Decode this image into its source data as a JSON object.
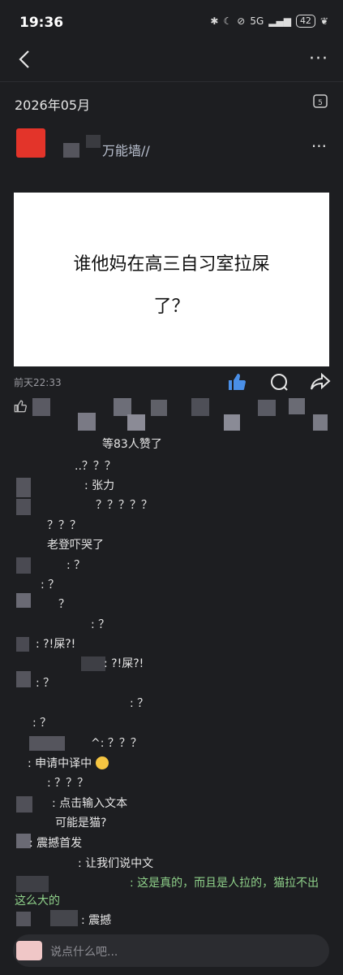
{
  "status_bar": {
    "time": "19:36",
    "network": "5G",
    "battery": "42"
  },
  "header": {
    "date": "2026年05月",
    "calendar_day": "5"
  },
  "post": {
    "author_name": "万能墙//",
    "image_text_line1": "谁他妈在高三自习室拉屎",
    "image_text_line2": "了？",
    "time": "前天22:33",
    "likes_text": "等83人赞了"
  },
  "comments": [
    {
      "text": "..？？？"
    },
    {
      "text": ": 张力"
    },
    {
      "text": "？？？？？"
    },
    {
      "text": "？？？"
    },
    {
      "text": "老登吓哭了"
    },
    {
      "text": ": ？"
    },
    {
      "text": ": ？"
    },
    {
      "text": "？"
    },
    {
      "text": ": ？"
    },
    {
      "text": ": ?!屎?!"
    },
    {
      "text": ": ?!屎?!"
    },
    {
      "text": ": ？"
    },
    {
      "text": ": ？"
    },
    {
      "text": ": ？"
    },
    {
      "text": "^: ？？？"
    },
    {
      "text": ": 申请中译中"
    },
    {
      "text": ": ？？？"
    },
    {
      "text": ": 点击输入文本"
    },
    {
      "text": "可能是猫?"
    },
    {
      "text": ": 震撼首发"
    },
    {
      "text": ": 让我们说中文"
    },
    {
      "text": ": 这是真的，而且是人拉的，猫拉不出这么大的"
    },
    {
      "text": ": 震撼"
    }
  ],
  "input": {
    "placeholder": "说点什么吧..."
  },
  "colors": {
    "background": "#1d1e21",
    "like_blue": "#4a8fe7",
    "green_comment": "#8fd18a",
    "avatar_red": "#e3342a"
  }
}
